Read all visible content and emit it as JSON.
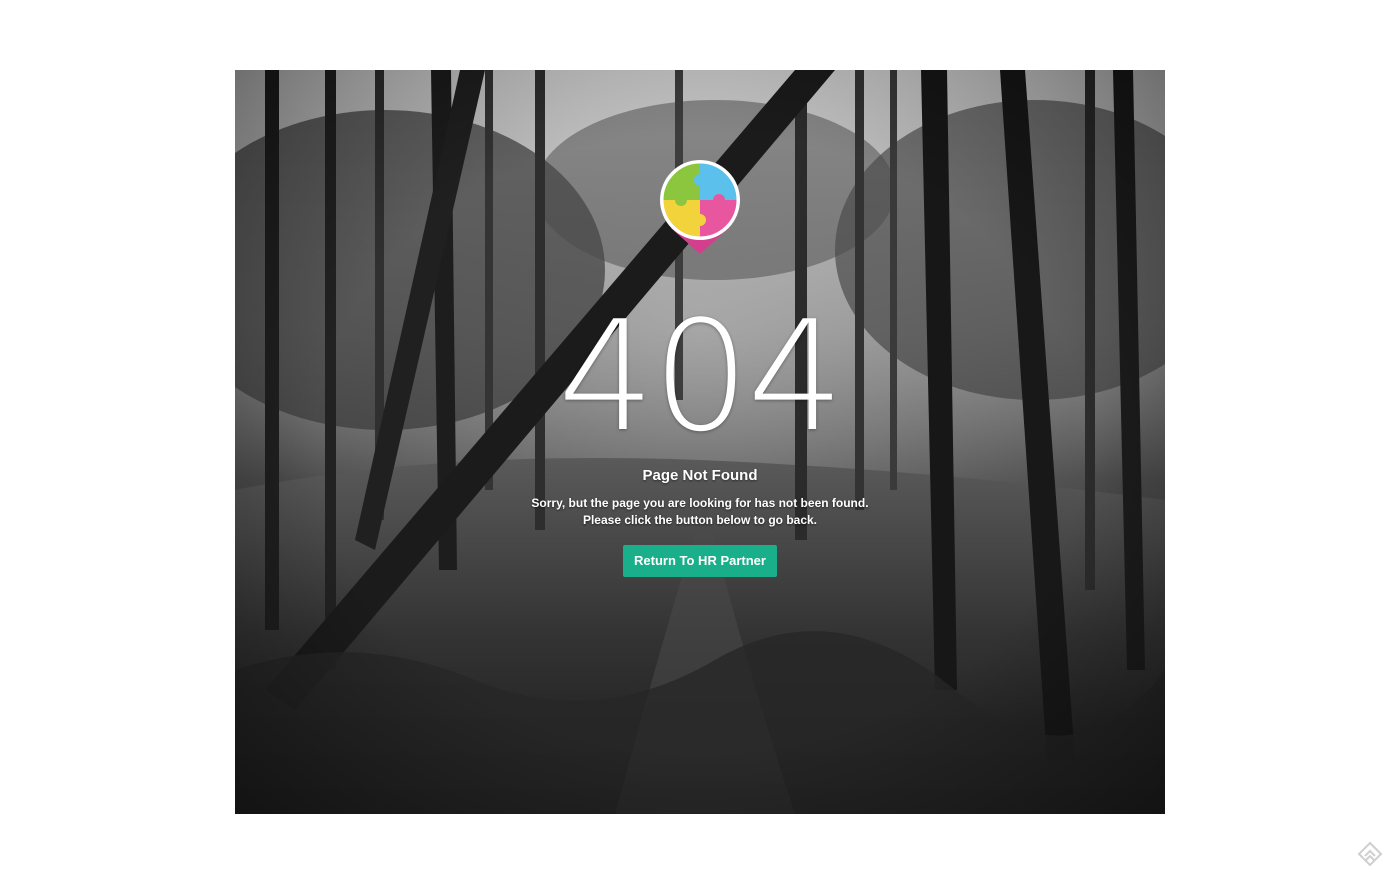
{
  "error": {
    "code": "404",
    "title": "Page Not Found",
    "message_line1": "Sorry, but the page you are looking for has not been found.",
    "message_line2": "Please click the button below to go back."
  },
  "actions": {
    "return_label": "Return To HR Partner"
  },
  "colors": {
    "button": "#1aaf8b",
    "text": "#ffffff",
    "page_background": "#ffffff"
  },
  "icons": {
    "logo": "puzzle-heart-logo",
    "corner": "diamond-arrow-icon"
  }
}
